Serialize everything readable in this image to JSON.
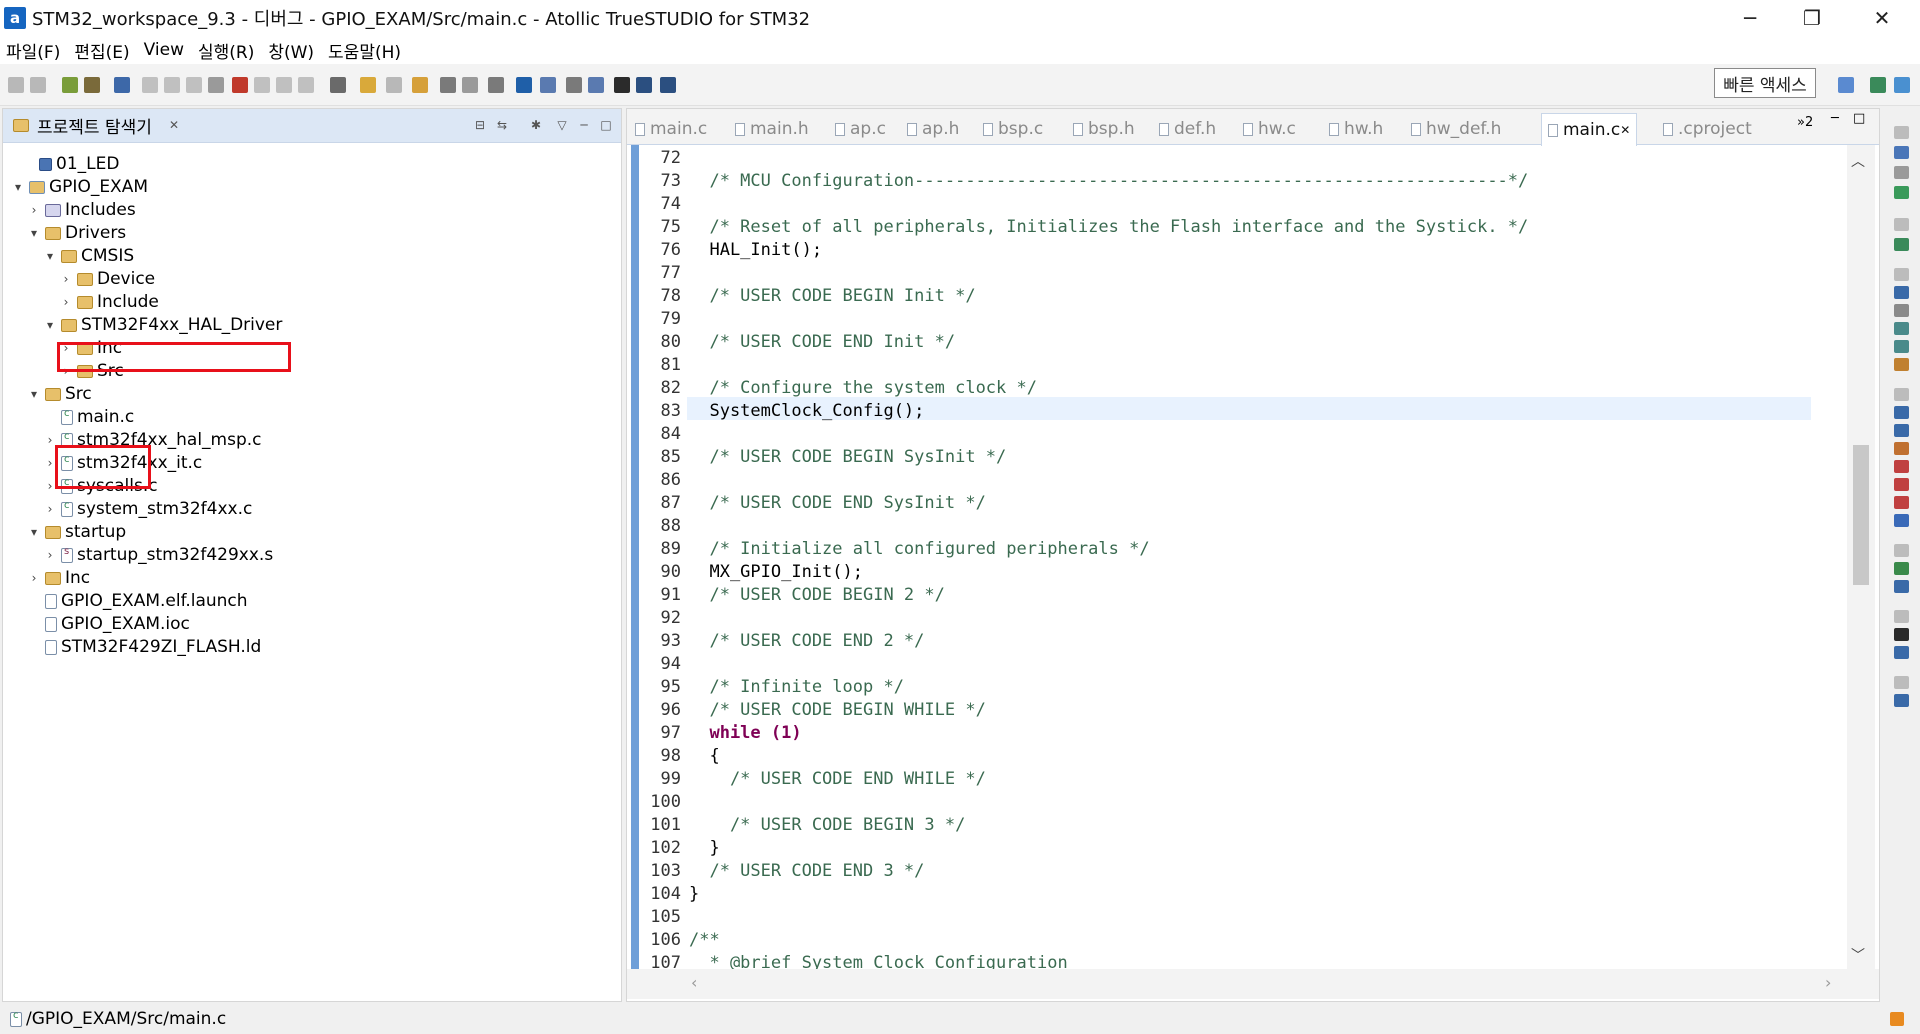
{
  "window": {
    "title": "STM32_workspace_9.3 - 디버그 - GPIO_EXAM/Src/main.c - Atollic TrueSTUDIO for STM32",
    "logo": "a",
    "minimize": "─",
    "maximize": "❐",
    "close": "✕"
  },
  "menubar": {
    "items": [
      "파일(F)",
      "편집(E)",
      "View",
      "실행(R)",
      "창(W)",
      "도움말(H)"
    ]
  },
  "toolbar": {
    "quick_access": "빠른 액세스"
  },
  "explorer": {
    "title": "프로젝트 탐색기",
    "tree": [
      {
        "label": "01_LED",
        "arrow": "",
        "icon": "blueproj"
      },
      {
        "label": "GPIO_EXAM",
        "arrow": "▾",
        "icon": "project"
      },
      {
        "label": "Includes",
        "arrow": "›",
        "icon": "includes"
      },
      {
        "label": "Drivers",
        "arrow": "▾",
        "icon": "folder"
      },
      {
        "label": "CMSIS",
        "arrow": "▾",
        "icon": "folder"
      },
      {
        "label": "Device",
        "arrow": "›",
        "icon": "folder"
      },
      {
        "label": "Include",
        "arrow": "›",
        "icon": "folder"
      },
      {
        "label": "STM32F4xx_HAL_Driver",
        "arrow": "▾",
        "icon": "folder"
      },
      {
        "label": "Inc",
        "arrow": "›",
        "icon": "folder"
      },
      {
        "label": "Src",
        "arrow": "›",
        "icon": "folder"
      },
      {
        "label": "Src",
        "arrow": "▾",
        "icon": "folder"
      },
      {
        "label": "main.c",
        "arrow": "",
        "icon": "cfile"
      },
      {
        "label": "stm32f4xx_hal_msp.c",
        "arrow": "›",
        "icon": "cfile"
      },
      {
        "label": "stm32f4xx_it.c",
        "arrow": "›",
        "icon": "cfile"
      },
      {
        "label": "syscalls.c",
        "arrow": "›",
        "icon": "cfile"
      },
      {
        "label": "system_stm32f4xx.c",
        "arrow": "›",
        "icon": "cfile"
      },
      {
        "label": "startup",
        "arrow": "▾",
        "icon": "folder"
      },
      {
        "label": "startup_stm32f429xx.s",
        "arrow": "›",
        "icon": "sfile"
      },
      {
        "label": "Inc",
        "arrow": "›",
        "icon": "folder"
      },
      {
        "label": "GPIO_EXAM.elf.launch",
        "arrow": "",
        "icon": "file"
      },
      {
        "label": "GPIO_EXAM.ioc",
        "arrow": "",
        "icon": "file"
      },
      {
        "label": "STM32F429ZI_FLASH.ld",
        "arrow": "",
        "icon": "file"
      }
    ]
  },
  "editor": {
    "tabs": [
      "main.c",
      "main.h",
      "ap.c",
      "ap.h",
      "bsp.c",
      "bsp.h",
      "def.h",
      "hw.c",
      "hw.h",
      "hw_def.h",
      "main.c",
      ".cproject"
    ],
    "overflow": "»2",
    "lines": [
      {
        "num": "72",
        "text": ""
      },
      {
        "num": "73",
        "text": "  /* MCU Configuration----------------------------------------------------------*/"
      },
      {
        "num": "74",
        "text": ""
      },
      {
        "num": "75",
        "text": "  /* Reset of all peripherals, Initializes the Flash interface and the Systick. */"
      },
      {
        "num": "76",
        "text": "  HAL_Init();"
      },
      {
        "num": "77",
        "text": ""
      },
      {
        "num": "78",
        "text": "  /* USER CODE BEGIN Init */"
      },
      {
        "num": "79",
        "text": ""
      },
      {
        "num": "80",
        "text": "  /* USER CODE END Init */"
      },
      {
        "num": "81",
        "text": ""
      },
      {
        "num": "82",
        "text": "  /* Configure the system clock */"
      },
      {
        "num": "83",
        "text": "  SystemClock_Config();"
      },
      {
        "num": "84",
        "text": ""
      },
      {
        "num": "85",
        "text": "  /* USER CODE BEGIN SysInit */"
      },
      {
        "num": "86",
        "text": ""
      },
      {
        "num": "87",
        "text": "  /* USER CODE END SysInit */"
      },
      {
        "num": "88",
        "text": ""
      },
      {
        "num": "89",
        "text": "  /* Initialize all configured peripherals */"
      },
      {
        "num": "90",
        "text": "  MX_GPIO_Init();"
      },
      {
        "num": "91",
        "text": "  /* USER CODE BEGIN 2 */"
      },
      {
        "num": "92",
        "text": ""
      },
      {
        "num": "93",
        "text": "  /* USER CODE END 2 */"
      },
      {
        "num": "94",
        "text": ""
      },
      {
        "num": "95",
        "text": "  /* Infinite loop */"
      },
      {
        "num": "96",
        "text": "  /* USER CODE BEGIN WHILE */"
      },
      {
        "num": "97",
        "text": "  while (1)"
      },
      {
        "num": "98",
        "text": "  {"
      },
      {
        "num": "99",
        "text": "    /* USER CODE END WHILE */"
      },
      {
        "num": "100",
        "text": ""
      },
      {
        "num": "101",
        "text": "    /* USER CODE BEGIN 3 */"
      },
      {
        "num": "102",
        "text": "  }"
      },
      {
        "num": "103",
        "text": "  /* USER CODE END 3 */"
      },
      {
        "num": "104",
        "text": "}"
      },
      {
        "num": "105",
        "text": ""
      },
      {
        "num": "106",
        "text": "/**"
      },
      {
        "num": "107",
        "text": "  * @brief System Clock Configuration"
      }
    ]
  },
  "status": {
    "path": "/GPIO_EXAM/Src/main.c"
  }
}
